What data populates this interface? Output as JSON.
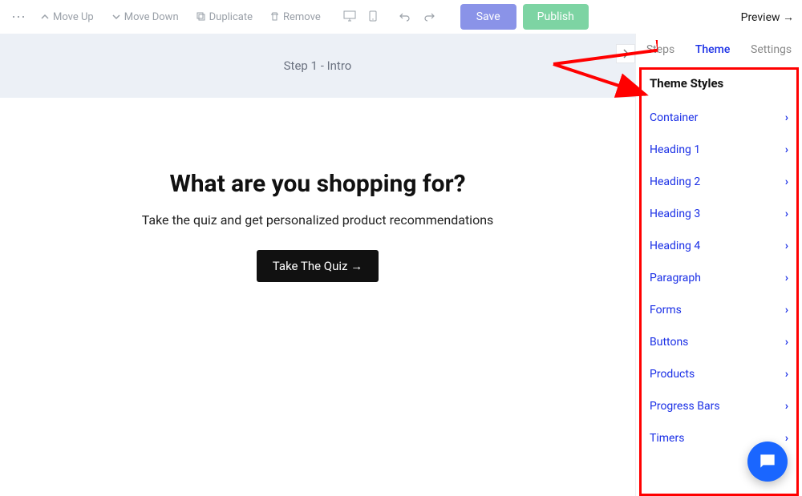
{
  "toolbar": {
    "moveUp": "Move Up",
    "moveDown": "Move Down",
    "duplicate": "Duplicate",
    "remove": "Remove",
    "save": "Save",
    "publish": "Publish",
    "preview": "Preview →"
  },
  "step": {
    "title": "Step 1 - Intro"
  },
  "canvas": {
    "headline": "What are you shopping for?",
    "subline": "Take the quiz and get personalized product recommendations",
    "cta": "Take The Quiz →"
  },
  "sidebar": {
    "tabs": {
      "steps": "Steps",
      "theme": "Theme",
      "settings": "Settings"
    },
    "panelTitle": "Theme Styles",
    "items": [
      {
        "label": "Container"
      },
      {
        "label": "Heading 1"
      },
      {
        "label": "Heading 2"
      },
      {
        "label": "Heading 3"
      },
      {
        "label": "Heading 4"
      },
      {
        "label": "Paragraph"
      },
      {
        "label": "Forms"
      },
      {
        "label": "Buttons"
      },
      {
        "label": "Products"
      },
      {
        "label": "Progress Bars"
      },
      {
        "label": "Timers"
      }
    ]
  },
  "icons": {
    "chevronUp": "˄",
    "chevronDown": "˅",
    "chevronRight": "›"
  }
}
